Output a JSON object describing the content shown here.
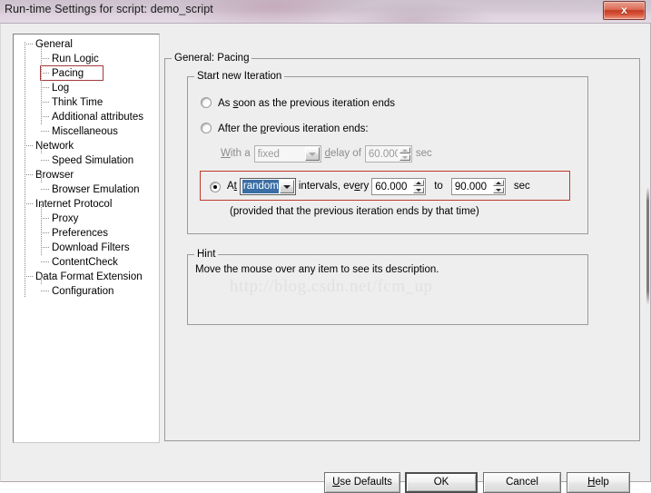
{
  "window": {
    "title": "Run-time Settings for script: demo_script",
    "close_label": "x"
  },
  "tree": {
    "items": [
      {
        "label": "General",
        "level": 0,
        "selected": false
      },
      {
        "label": "Run Logic",
        "level": 1,
        "selected": false
      },
      {
        "label": "Pacing",
        "level": 1,
        "selected": true
      },
      {
        "label": "Log",
        "level": 1,
        "selected": false
      },
      {
        "label": "Think Time",
        "level": 1,
        "selected": false
      },
      {
        "label": "Additional attributes",
        "level": 1,
        "selected": false
      },
      {
        "label": "Miscellaneous",
        "level": 1,
        "selected": false
      },
      {
        "label": "Network",
        "level": 0,
        "selected": false
      },
      {
        "label": "Speed Simulation",
        "level": 1,
        "selected": false
      },
      {
        "label": "Browser",
        "level": 0,
        "selected": false
      },
      {
        "label": "Browser Emulation",
        "level": 1,
        "selected": false
      },
      {
        "label": "Internet Protocol",
        "level": 0,
        "selected": false
      },
      {
        "label": "Proxy",
        "level": 1,
        "selected": false
      },
      {
        "label": "Preferences",
        "level": 1,
        "selected": false
      },
      {
        "label": "Download Filters",
        "level": 1,
        "selected": false
      },
      {
        "label": "ContentCheck",
        "level": 1,
        "selected": false
      },
      {
        "label": "Data Format Extension",
        "level": 0,
        "selected": false
      },
      {
        "label": "Configuration",
        "level": 1,
        "selected": false
      }
    ],
    "selection_highlight_color": "#a03b3b"
  },
  "main": {
    "group_title": "General: Pacing",
    "start_new_iteration": {
      "group_title": "Start new Iteration",
      "option_asap": {
        "label_before": "As ",
        "label_accel": "s",
        "label_after": "oon as the previous iteration ends",
        "selected": false
      },
      "option_after_previous": {
        "label_before": "After the ",
        "label_accel": "p",
        "label_after": "revious iteration ends:",
        "selected": false
      },
      "delay_row": {
        "enabled": false,
        "with_a_accel": "W",
        "with_a_rest": "ith a",
        "delay_of_accel": "d",
        "delay_of_rest": "elay of",
        "type_value": "fixed",
        "delay_value": "60.000",
        "unit": "sec"
      },
      "option_at_intervals": {
        "selected": true,
        "at_label_before": "A",
        "at_label_accel": "t",
        "interval_type_value": "random",
        "intervals_text": "intervals, ev",
        "every_accel": "e",
        "every_rest": "ry",
        "from_value": "60.000",
        "to_label": "to",
        "to_value": "90.000",
        "unit": "sec",
        "highlight_color": "#c0392b"
      },
      "provided_note": "(provided that the previous iteration ends by that time)"
    },
    "hint": {
      "group_title": "Hint",
      "text": "Move the mouse over any item to see its description."
    },
    "watermark": "http://blog.csdn.net/fcm_up"
  },
  "buttons": {
    "use_defaults": {
      "accel": "U",
      "rest": "se Defaults"
    },
    "ok": {
      "label": "OK"
    },
    "cancel": {
      "label": "Cancel"
    },
    "help": {
      "accel": "H",
      "rest": "elp"
    }
  }
}
